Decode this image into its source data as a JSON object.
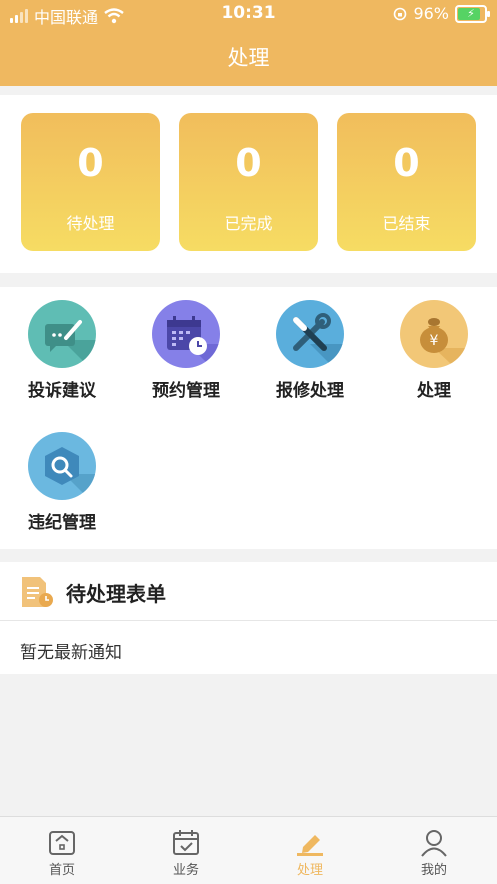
{
  "status_bar": {
    "carrier": "中国联通",
    "time": "10:31",
    "battery": "96%"
  },
  "header": {
    "title": "处理"
  },
  "stats": [
    {
      "value": "0",
      "label": "待处理"
    },
    {
      "value": "0",
      "label": "已完成"
    },
    {
      "value": "0",
      "label": "已结束"
    }
  ],
  "grid": [
    {
      "label": "投诉建议",
      "icon": "chat-pen-icon",
      "color": "#5fbdb4"
    },
    {
      "label": "预约管理",
      "icon": "calendar-clock-icon",
      "color": "#8580e8"
    },
    {
      "label": "报修处理",
      "icon": "wrench-screwdriver-icon",
      "color": "#5aaedc"
    },
    {
      "label": "处理",
      "icon": "money-bag-icon",
      "color": "#f2c777"
    },
    {
      "label": "违纪管理",
      "icon": "search-hexagon-icon",
      "color": "#6bb8e0"
    }
  ],
  "pending": {
    "title": "待处理表单",
    "empty": "暂无最新通知"
  },
  "tabs": [
    {
      "label": "首页",
      "icon": "home-icon"
    },
    {
      "label": "业务",
      "icon": "calendar-check-icon"
    },
    {
      "label": "处理",
      "icon": "pen-icon",
      "active": true
    },
    {
      "label": "我的",
      "icon": "user-icon"
    }
  ],
  "colors": {
    "accent": "#efb860"
  }
}
